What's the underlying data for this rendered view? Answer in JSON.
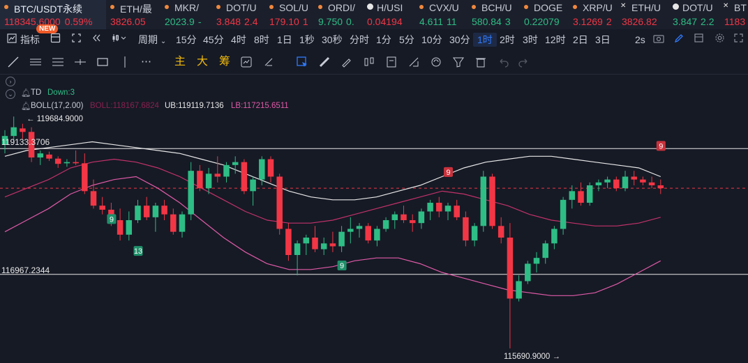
{
  "tickers": [
    {
      "symbol": "BTC/USDT永续",
      "price": "118345.6000",
      "change": "0.59%",
      "color": "red"
    },
    {
      "symbol": "ETH/最",
      "price": "3826.05",
      "color": "red"
    },
    {
      "symbol": "MKR/",
      "price": "2023.9",
      "extra": "-",
      "color": "green"
    },
    {
      "symbol": "DOT/U",
      "price": "3.848",
      "extra": "2.4",
      "color": "red"
    },
    {
      "symbol": "SOL/U",
      "price": "179.10",
      "extra": "1",
      "color": "red"
    },
    {
      "symbol": "ORDI/",
      "price": "9.750",
      "extra": "0.",
      "color": "green"
    },
    {
      "symbol": "H/USI",
      "price": "0.04194",
      "color": "red"
    },
    {
      "symbol": "CVX/U",
      "price": "4.611",
      "extra": "11",
      "color": "green"
    },
    {
      "symbol": "BCH/U",
      "price": "580.84",
      "extra": "3",
      "color": "green"
    },
    {
      "symbol": "DOGE",
      "price": "0.22079",
      "color": "green"
    },
    {
      "symbol": "XRP/U",
      "price": "3.1269",
      "extra": "2",
      "color": "red"
    },
    {
      "symbol": "ETH/U",
      "price": "3826.82",
      "color": "red"
    },
    {
      "symbol": "DOT/U",
      "price": "3.847",
      "extra": "2.2",
      "color": "green"
    },
    {
      "symbol": "BT",
      "price": "1183",
      "color": "red"
    }
  ],
  "new_badge": "NEW",
  "toolbar": {
    "indicators": "指标",
    "period": "周期",
    "intervals": [
      "15分",
      "45分",
      "4时",
      "8时",
      "1日",
      "1秒",
      "30秒",
      "分时",
      "1分",
      "5分",
      "10分",
      "30分",
      "1时",
      "2时",
      "3时",
      "12时",
      "2日",
      "3日"
    ],
    "active_interval": "1时",
    "right_label": "2s"
  },
  "drawbar": {
    "main": "主",
    "big": "大",
    "chips": "筹"
  },
  "indicators": {
    "td_name": "TD",
    "td_value": "Down:3",
    "boll_name": "BOLL(17,2.00)",
    "boll_mid": "BOLL:118167.6824",
    "boll_ub": "UB:119119.7136",
    "boll_lb": "LB:117215.6511"
  },
  "chart_labels": {
    "high_marker": "← 119684.9000",
    "low_marker": "115690.9000 →",
    "hline_top": "119133.3706",
    "hline_bottom": "116967.2344",
    "td_counts": [
      "9",
      "13",
      "9",
      "9",
      "9"
    ]
  },
  "colors": {
    "up": "#2ebd85",
    "down": "#f23645",
    "ub": "#e8e8e8",
    "mid": "#c2326a",
    "lb": "#e05aa8",
    "accent": "#2f7bff"
  },
  "chart_data": {
    "type": "candlestick",
    "interval": "1时",
    "price_range": [
      115690.9,
      119684.9
    ],
    "high": 119684.9,
    "low": 115690.9,
    "candles": [
      {
        "o": 119200,
        "h": 119450,
        "l": 119050,
        "c": 119350
      },
      {
        "o": 119350,
        "h": 119685,
        "l": 119250,
        "c": 119500
      },
      {
        "o": 119480,
        "h": 119560,
        "l": 119300,
        "c": 119420
      },
      {
        "o": 119420,
        "h": 119500,
        "l": 118900,
        "c": 118980
      },
      {
        "o": 118980,
        "h": 119100,
        "l": 118850,
        "c": 119050
      },
      {
        "o": 119030,
        "h": 119080,
        "l": 118920,
        "c": 118960
      },
      {
        "o": 118960,
        "h": 119000,
        "l": 118800,
        "c": 118870
      },
      {
        "o": 118880,
        "h": 118950,
        "l": 118820,
        "c": 118900
      },
      {
        "o": 118900,
        "h": 119100,
        "l": 118850,
        "c": 118880
      },
      {
        "o": 118880,
        "h": 119050,
        "l": 118350,
        "c": 118400
      },
      {
        "o": 118400,
        "h": 118600,
        "l": 118100,
        "c": 118150
      },
      {
        "o": 118150,
        "h": 118300,
        "l": 118000,
        "c": 118080
      },
      {
        "o": 118080,
        "h": 118200,
        "l": 117800,
        "c": 117900
      },
      {
        "o": 117900,
        "h": 118100,
        "l": 117550,
        "c": 117650
      },
      {
        "o": 117650,
        "h": 118050,
        "l": 117550,
        "c": 117900
      },
      {
        "o": 117900,
        "h": 118250,
        "l": 117850,
        "c": 118150
      },
      {
        "o": 118150,
        "h": 118300,
        "l": 117900,
        "c": 117950
      },
      {
        "o": 117950,
        "h": 118200,
        "l": 117700,
        "c": 118150
      },
      {
        "o": 118150,
        "h": 118250,
        "l": 117900,
        "c": 118000
      },
      {
        "o": 118000,
        "h": 118100,
        "l": 117650,
        "c": 117700
      },
      {
        "o": 117700,
        "h": 118050,
        "l": 117600,
        "c": 118000
      },
      {
        "o": 118000,
        "h": 118900,
        "l": 117900,
        "c": 118750
      },
      {
        "o": 118750,
        "h": 118850,
        "l": 118400,
        "c": 118450
      },
      {
        "o": 118450,
        "h": 118800,
        "l": 118350,
        "c": 118700
      },
      {
        "o": 118700,
        "h": 119000,
        "l": 118550,
        "c": 118650
      },
      {
        "o": 118650,
        "h": 118900,
        "l": 118550,
        "c": 118850
      },
      {
        "o": 118850,
        "h": 119000,
        "l": 118700,
        "c": 118900
      },
      {
        "o": 118900,
        "h": 118950,
        "l": 118350,
        "c": 118400
      },
      {
        "o": 118400,
        "h": 118650,
        "l": 118150,
        "c": 118600
      },
      {
        "o": 118600,
        "h": 119000,
        "l": 118500,
        "c": 118950
      },
      {
        "o": 118950,
        "h": 119000,
        "l": 118550,
        "c": 118650
      },
      {
        "o": 118650,
        "h": 118700,
        "l": 117650,
        "c": 117750
      },
      {
        "o": 117750,
        "h": 117850,
        "l": 117200,
        "c": 117300
      },
      {
        "o": 117300,
        "h": 117550,
        "l": 116950,
        "c": 117500
      },
      {
        "o": 117500,
        "h": 117650,
        "l": 117300,
        "c": 117600
      },
      {
        "o": 117600,
        "h": 117800,
        "l": 117350,
        "c": 117400
      },
      {
        "o": 117400,
        "h": 117600,
        "l": 117300,
        "c": 117500
      },
      {
        "o": 117500,
        "h": 117700,
        "l": 117350,
        "c": 117450
      },
      {
        "o": 117450,
        "h": 117800,
        "l": 117350,
        "c": 117700
      },
      {
        "o": 117700,
        "h": 117950,
        "l": 117500,
        "c": 117750
      },
      {
        "o": 117750,
        "h": 117850,
        "l": 117600,
        "c": 117800
      },
      {
        "o": 117800,
        "h": 117850,
        "l": 117500,
        "c": 117550
      },
      {
        "o": 117550,
        "h": 117800,
        "l": 117450,
        "c": 117750
      },
      {
        "o": 117750,
        "h": 117950,
        "l": 117700,
        "c": 117900
      },
      {
        "o": 117900,
        "h": 118050,
        "l": 117750,
        "c": 118000
      },
      {
        "o": 118000,
        "h": 118150,
        "l": 117850,
        "c": 117900
      },
      {
        "o": 117900,
        "h": 118000,
        "l": 117700,
        "c": 117850
      },
      {
        "o": 117850,
        "h": 118100,
        "l": 117750,
        "c": 118050
      },
      {
        "o": 118050,
        "h": 118250,
        "l": 117900,
        "c": 118200
      },
      {
        "o": 118200,
        "h": 118300,
        "l": 117950,
        "c": 118050
      },
      {
        "o": 118050,
        "h": 118200,
        "l": 117900,
        "c": 118150
      },
      {
        "o": 118150,
        "h": 118250,
        "l": 117900,
        "c": 117950
      },
      {
        "o": 117950,
        "h": 118050,
        "l": 117450,
        "c": 117550
      },
      {
        "o": 117550,
        "h": 117850,
        "l": 117450,
        "c": 117800
      },
      {
        "o": 117800,
        "h": 118750,
        "l": 117700,
        "c": 118650
      },
      {
        "o": 118650,
        "h": 118700,
        "l": 117750,
        "c": 117800
      },
      {
        "o": 117800,
        "h": 117950,
        "l": 117500,
        "c": 117600
      },
      {
        "o": 117600,
        "h": 117850,
        "l": 115690.9,
        "c": 116550
      },
      {
        "o": 116550,
        "h": 116950,
        "l": 116500,
        "c": 116850
      },
      {
        "o": 116850,
        "h": 117200,
        "l": 116800,
        "c": 117150
      },
      {
        "o": 117150,
        "h": 117350,
        "l": 117000,
        "c": 117250
      },
      {
        "o": 117250,
        "h": 117550,
        "l": 117150,
        "c": 117500
      },
      {
        "o": 117500,
        "h": 117800,
        "l": 117400,
        "c": 117750
      },
      {
        "o": 117750,
        "h": 118300,
        "l": 117650,
        "c": 118250
      },
      {
        "o": 118250,
        "h": 118500,
        "l": 118100,
        "c": 118400
      },
      {
        "o": 118400,
        "h": 118550,
        "l": 118150,
        "c": 118200
      },
      {
        "o": 118200,
        "h": 118550,
        "l": 118150,
        "c": 118500
      },
      {
        "o": 118500,
        "h": 118600,
        "l": 118400,
        "c": 118550
      },
      {
        "o": 118550,
        "h": 118650,
        "l": 118450,
        "c": 118600
      },
      {
        "o": 118600,
        "h": 118650,
        "l": 118400,
        "c": 118450
      },
      {
        "o": 118450,
        "h": 118750,
        "l": 118400,
        "c": 118650
      },
      {
        "o": 118650,
        "h": 118750,
        "l": 118500,
        "c": 118600
      },
      {
        "o": 118600,
        "h": 118650,
        "l": 118500,
        "c": 118550
      },
      {
        "o": 118550,
        "h": 118650,
        "l": 118450,
        "c": 118500
      },
      {
        "o": 118500,
        "h": 118600,
        "l": 118350,
        "c": 118450
      }
    ],
    "boll_ub_series": [
      119000,
      119100,
      119150,
      119200,
      119250,
      119200,
      119150,
      119100,
      119050,
      118950,
      118850,
      118700,
      118550,
      118400,
      118300,
      118250,
      118250,
      118300,
      118400,
      118500,
      118650,
      118800,
      118900,
      118950,
      119000,
      119000,
      118950,
      118900,
      118850,
      118800,
      118650
    ],
    "boll_mid_series": [
      118300,
      118450,
      118600,
      118800,
      118900,
      118950,
      118900,
      118800,
      118650,
      118450,
      118250,
      118050,
      117900,
      117850,
      117850,
      117900,
      118000,
      118100,
      118200,
      118300,
      118400,
      118350,
      118250,
      118150,
      118000,
      117900,
      117850,
      117800,
      117800,
      117850,
      117950
    ],
    "boll_lb_series": [
      117700,
      117900,
      118100,
      118350,
      118500,
      118600,
      118650,
      118450,
      118200,
      117900,
      117600,
      117350,
      117150,
      117050,
      117050,
      117100,
      117200,
      117250,
      117250,
      117150,
      117000,
      116900,
      116800,
      116700,
      116650,
      116600,
      116600,
      116650,
      116800,
      117000,
      117200
    ],
    "xlabel": "",
    "ylabel": ""
  }
}
